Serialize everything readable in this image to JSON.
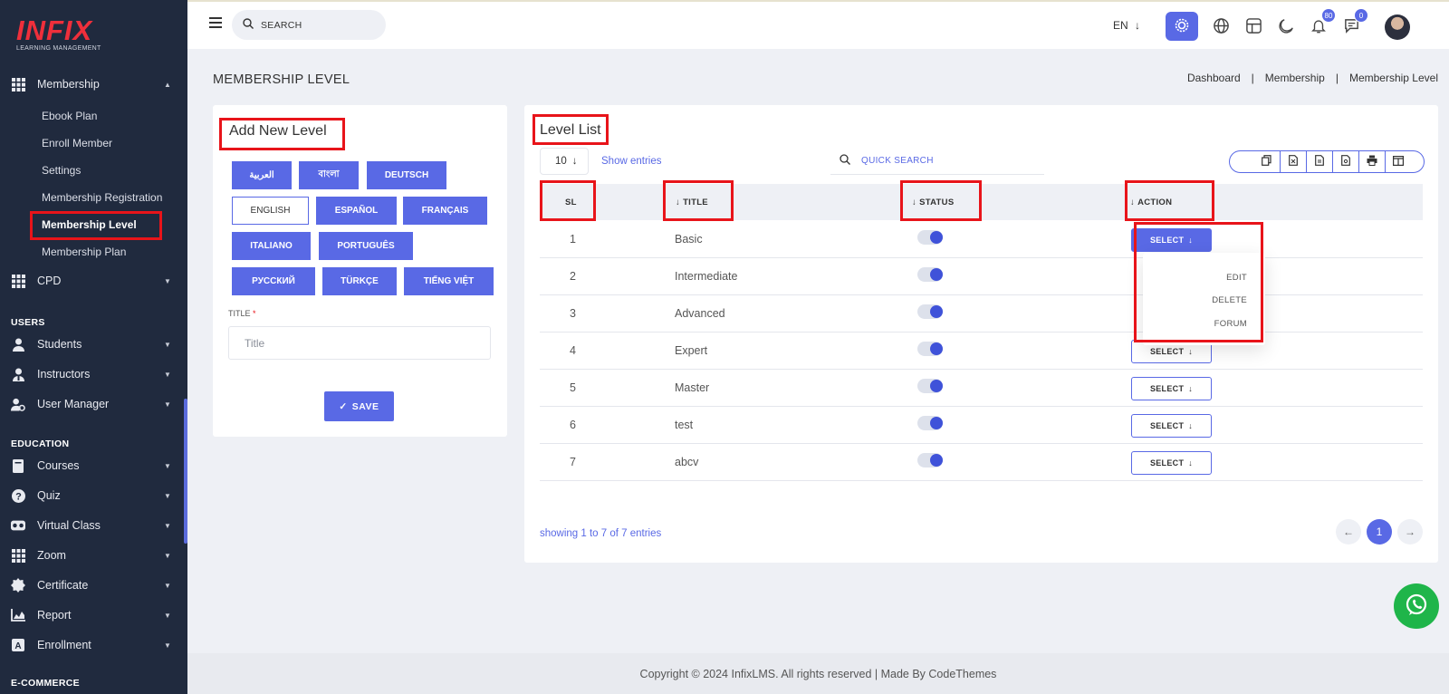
{
  "brand": {
    "name": "INFIX",
    "tagline": "LEARNING MANAGEMENT"
  },
  "colors": {
    "accent": "#5969e5",
    "sidebar": "#202a3e",
    "highlight": "#e8141a",
    "whatsapp": "#1fb54a"
  },
  "sidebar": {
    "membership": {
      "label": "Membership",
      "icon": "grid-icon",
      "children": [
        "Ebook Plan",
        "Enroll Member",
        "Settings",
        "Membership Registration",
        "Membership Level",
        "Membership Plan"
      ]
    },
    "cpd": {
      "label": "CPD",
      "icon": "grid-icon"
    },
    "users_heading": "USERS",
    "users": [
      {
        "label": "Students",
        "icon": "user-icon"
      },
      {
        "label": "Instructors",
        "icon": "instructor-icon"
      },
      {
        "label": "User Manager",
        "icon": "user-gear-icon"
      }
    ],
    "education_heading": "EDUCATION",
    "education": [
      {
        "label": "Courses",
        "icon": "book-icon"
      },
      {
        "label": "Quiz",
        "icon": "question-icon"
      },
      {
        "label": "Virtual Class",
        "icon": "vr-icon"
      },
      {
        "label": "Zoom",
        "icon": "grid-icon"
      },
      {
        "label": "Certificate",
        "icon": "badge-icon"
      },
      {
        "label": "Report",
        "icon": "chart-icon"
      },
      {
        "label": "Enrollment",
        "icon": "enroll-icon"
      }
    ],
    "ecommerce_heading": "E-COMMERCE"
  },
  "topbar": {
    "search_placeholder": "SEARCH",
    "language": "EN",
    "notifications_count": "80",
    "messages_count": "0"
  },
  "page": {
    "title": "MEMBERSHIP LEVEL",
    "breadcrumb": [
      "Dashboard",
      "Membership",
      "Membership Level"
    ]
  },
  "add_level": {
    "title": "Add New Level",
    "languages": [
      "العربية",
      "বাংলা",
      "DEUTSCH",
      "ENGLISH",
      "ESPAÑOL",
      "FRANÇAIS",
      "ITALIANO",
      "PORTUGUÊS",
      "РУССКИЙ",
      "TÜRKÇE",
      "TIẾNG VIỆT"
    ],
    "selected_language": "ENGLISH",
    "field_label": "TITLE",
    "required_mark": "*",
    "title_placeholder": "Title",
    "save_label": "SAVE"
  },
  "level_list": {
    "title": "Level List",
    "entries_value": "10",
    "show_entries": "Show entries",
    "quick_search": "QUICK SEARCH",
    "columns": [
      "SL",
      "TITLE",
      "STATUS",
      "ACTION"
    ],
    "rows": [
      {
        "sl": "1",
        "title": "Basic",
        "status": true
      },
      {
        "sl": "2",
        "title": "Intermediate",
        "status": true
      },
      {
        "sl": "3",
        "title": "Advanced",
        "status": true
      },
      {
        "sl": "4",
        "title": "Expert",
        "status": true
      },
      {
        "sl": "5",
        "title": "Master",
        "status": true
      },
      {
        "sl": "6",
        "title": "test",
        "status": true
      },
      {
        "sl": "7",
        "title": "abcv",
        "status": true
      }
    ],
    "select_label": "SELECT",
    "dropdown": [
      "EDIT",
      "DELETE",
      "FORUM"
    ],
    "showing": "showing 1 to 7 of 7 entries",
    "current_page": "1"
  },
  "footer": {
    "text": "Copyright © 2024 InfixLMS. All rights reserved | Made By CodeThemes"
  }
}
